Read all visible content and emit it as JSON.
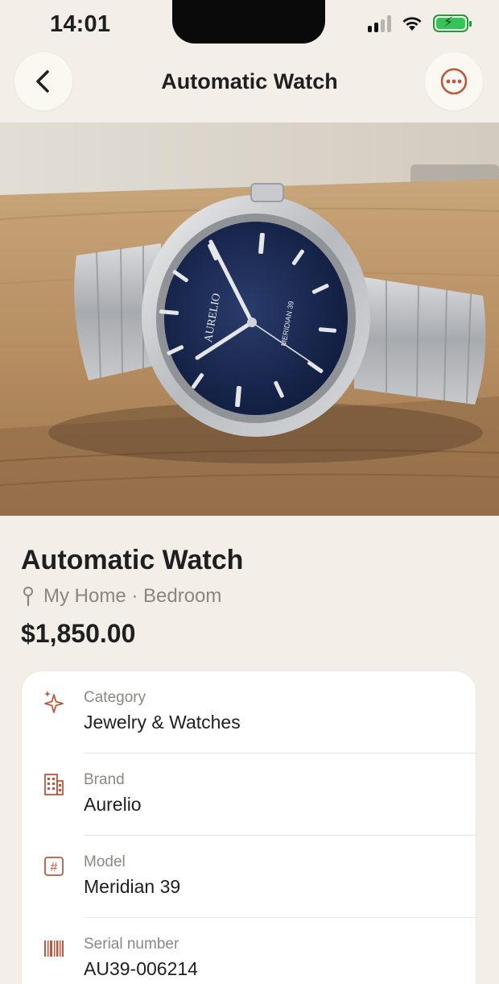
{
  "status_bar": {
    "time": "14:01"
  },
  "nav": {
    "title": "Automatic Watch"
  },
  "hero": {
    "dial_brand": "AURELIO",
    "dial_model": "MERIDIAN 39"
  },
  "item": {
    "title": "Automatic Watch",
    "location": "My Home · Bedroom",
    "price": "$1,850.00"
  },
  "details": [
    {
      "label": "Category",
      "value": "Jewelry & Watches",
      "icon": "sparkle-icon"
    },
    {
      "label": "Brand",
      "value": "Aurelio",
      "icon": "building-icon"
    },
    {
      "label": "Model",
      "value": "Meridian 39",
      "icon": "hash-icon"
    },
    {
      "label": "Serial number",
      "value": "AU39-006214",
      "icon": "barcode-icon"
    }
  ],
  "colors": {
    "accent": "#C0573C",
    "background": "#F3EFE8",
    "card": "#FFFFFF",
    "secondary_text": "#8A8580"
  }
}
